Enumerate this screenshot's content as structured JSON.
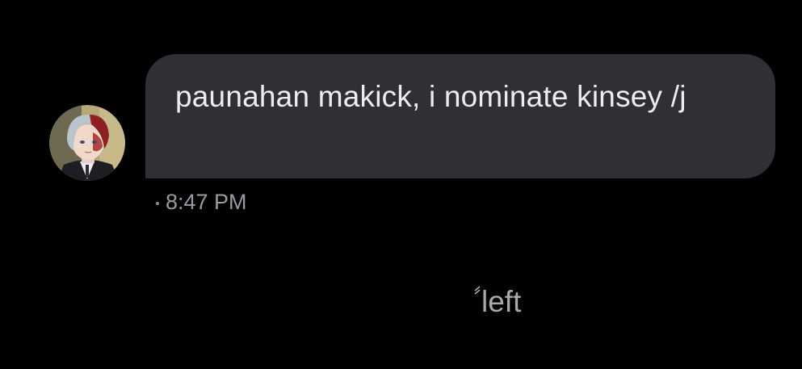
{
  "message": {
    "text": "paunahan makick, i nominate kinsey /j",
    "time": "8:47 PM",
    "avatar_icon": "avatar-icon"
  },
  "status": {
    "text": "left"
  },
  "colors": {
    "background": "#000000",
    "bubble": "#2e3034",
    "bubble_text": "#ededed",
    "meta_text": "#9a9ca1"
  }
}
